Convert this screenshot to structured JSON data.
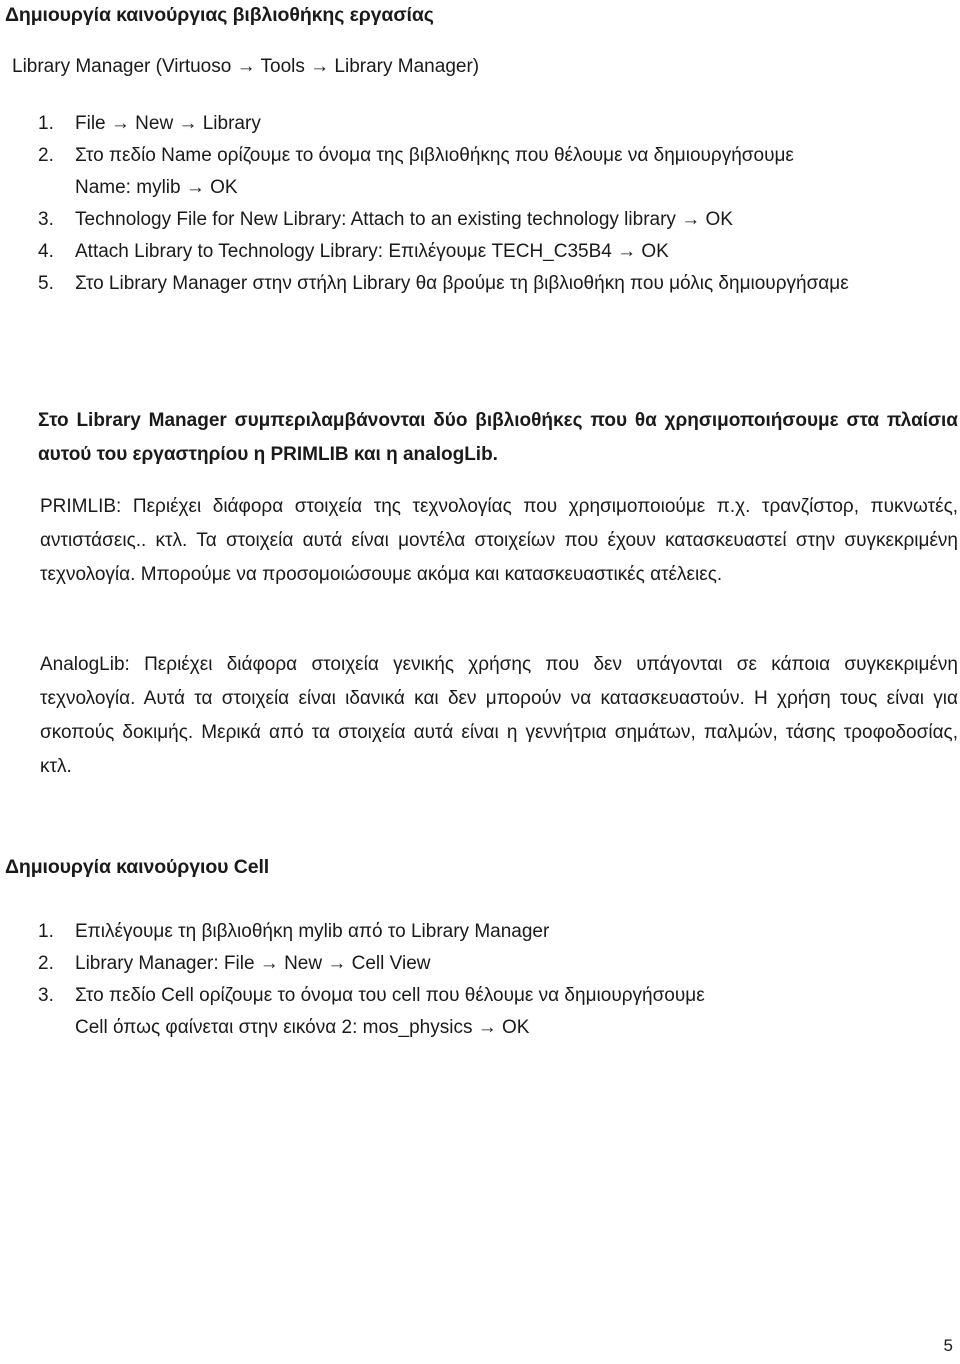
{
  "document": {
    "page_number": "5",
    "text_color": "#1a1a1a",
    "background_color": "#ffffff"
  },
  "section_1": {
    "heading": "Δημιουργία καινούργιας βιβλιοθήκης εργασίας",
    "intro": "Library Manager (Virtuoso → Tools → Library Manager)",
    "steps": [
      {
        "marker": "1.",
        "text": "File → New → Library",
        "sub": ""
      },
      {
        "marker": "2.",
        "text": "Στο πεδίο Name ορίζουμε το όνομα της βιβλιοθήκης που θέλουμε να δημιουργήσουμε",
        "sub": "Name: mylib → OK"
      },
      {
        "marker": "3.",
        "text": "Technology File for New Library: Attach to an existing technology library → OK",
        "sub": ""
      },
      {
        "marker": "4.",
        "text": "Attach Library to Technology Library: Επιλέγουμε TECH_C35B4 → OK",
        "sub": ""
      },
      {
        "marker": "5.",
        "text": "Στο Library Manager στην στήλη Library θα βρούμε τη βιβλιοθήκη που μόλις δημιουργήσαμε",
        "sub": ""
      }
    ],
    "paragraph_intro": "Στο Library Manager συμπεριλαμβάνονται δύο βιβλιοθήκες που θα χρησιμοποιήσουμε στα πλαίσια αυτού του εργαστηρίου η PRIMLIB και η analogLib.",
    "paragraph_primlib": "PRIMLIB: Περιέχει διάφορα στοιχεία της τεχνολογίας που χρησιμοποιούμε π.χ. τρανζίστορ, πυκνωτές, αντιστάσεις.. κτλ. Τα στοιχεία αυτά είναι μοντέλα στοιχείων που έχουν κατασκευαστεί στην συγκεκριμένη τεχνολογία. Μπορούμε να προσομοιώσουμε ακόμα και κατασκευαστικές ατέλειες.",
    "paragraph_analoglib": "AnalogLib: Περιέχει διάφορα στοιχεία γενικής χρήσης που δεν υπάγονται σε κάποια συγκεκριμένη τεχνολογία. Αυτά τα στοιχεία είναι ιδανικά και δεν μπορούν να κατασκευαστούν. Η χρήση τους είναι για σκοπούς δοκιμής. Μερικά από τα στοιχεία αυτά είναι η γεννήτρια σημάτων, παλμών, τάσης τροφοδοσίας, κτλ."
  },
  "section_2": {
    "heading": "Δημιουργία καινούργιου Cell",
    "steps": [
      {
        "marker": "1.",
        "text": "Επιλέγουμε τη βιβλιοθήκη mylib από το Library Manager",
        "sub": ""
      },
      {
        "marker": "2.",
        "text": "Library Manager: File → New → Cell View",
        "sub": ""
      },
      {
        "marker": "3.",
        "text": "Στο πεδίο Cell ορίζουμε το όνομα του cell που θέλουμε να δημιουργήσουμε",
        "sub": "Cell όπως φαίνεται στην εικόνα 2: mos_physics → OK"
      }
    ]
  }
}
